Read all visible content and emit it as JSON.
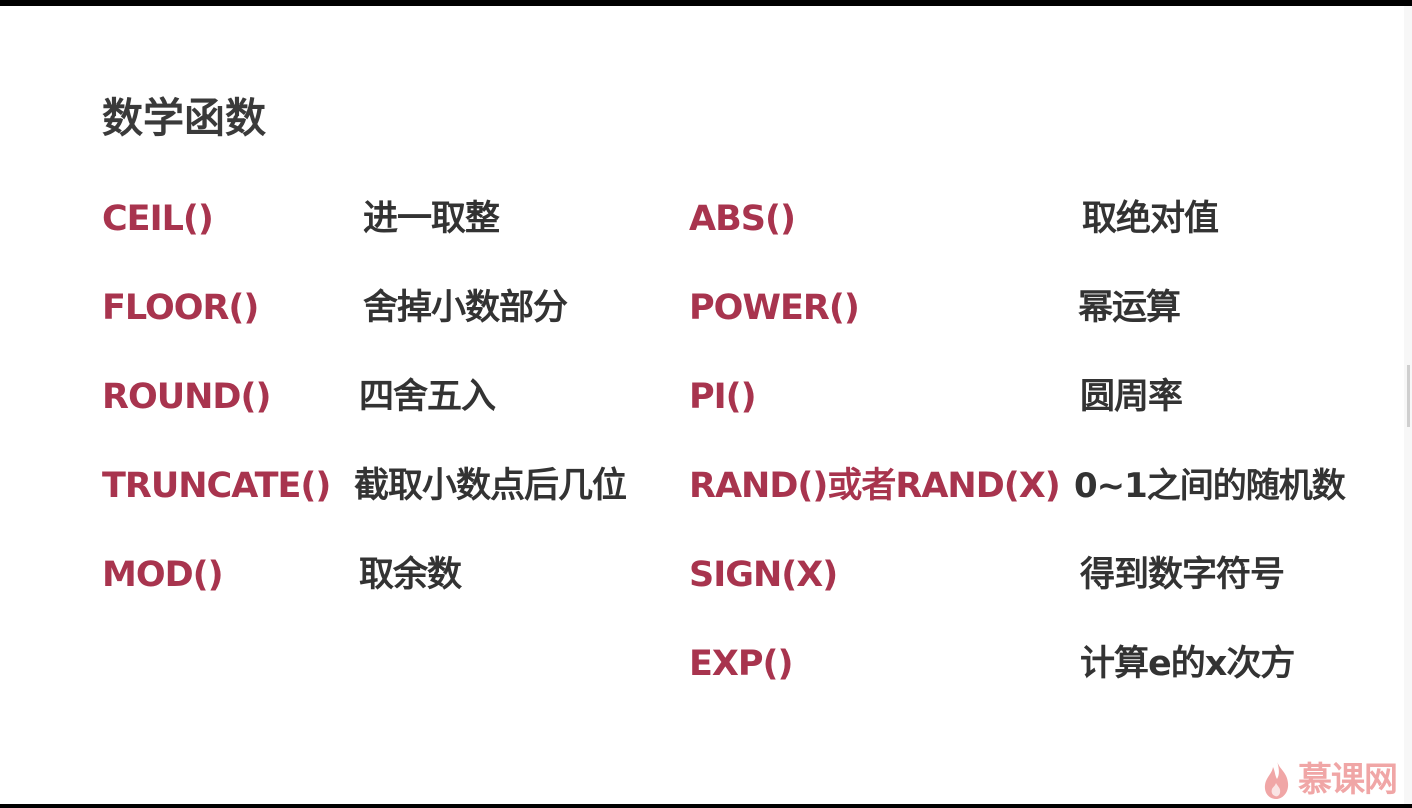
{
  "slide": {
    "title": "数学函数",
    "left_functions": [
      {
        "name": "CEIL()",
        "description": "进一取整"
      },
      {
        "name": "FLOOR()",
        "description": "舍掉小数部分"
      },
      {
        "name": "ROUND()",
        "description": "四舍五入"
      },
      {
        "name": "TRUNCATE()",
        "description": "截取小数点后几位"
      },
      {
        "name": "MOD()",
        "description": "取余数"
      }
    ],
    "right_functions": [
      {
        "name": "ABS()",
        "description": "取绝对值"
      },
      {
        "name": "POWER()",
        "description": "幂运算"
      },
      {
        "name": "PI()",
        "description": "圆周率"
      },
      {
        "name": "RAND()或者RAND(X)",
        "description": "0~1之间的随机数"
      },
      {
        "name": "SIGN(X)",
        "description": "得到数字符号"
      },
      {
        "name": "EXP()",
        "description": "计算e的x次方"
      }
    ]
  },
  "watermark": {
    "icon": "flame-icon",
    "text": "慕课网",
    "color": "#ef9a9a"
  },
  "colors": {
    "function_name": "#a8344e",
    "description": "#333333",
    "title": "#3a3a3a",
    "background": "#ffffff"
  }
}
